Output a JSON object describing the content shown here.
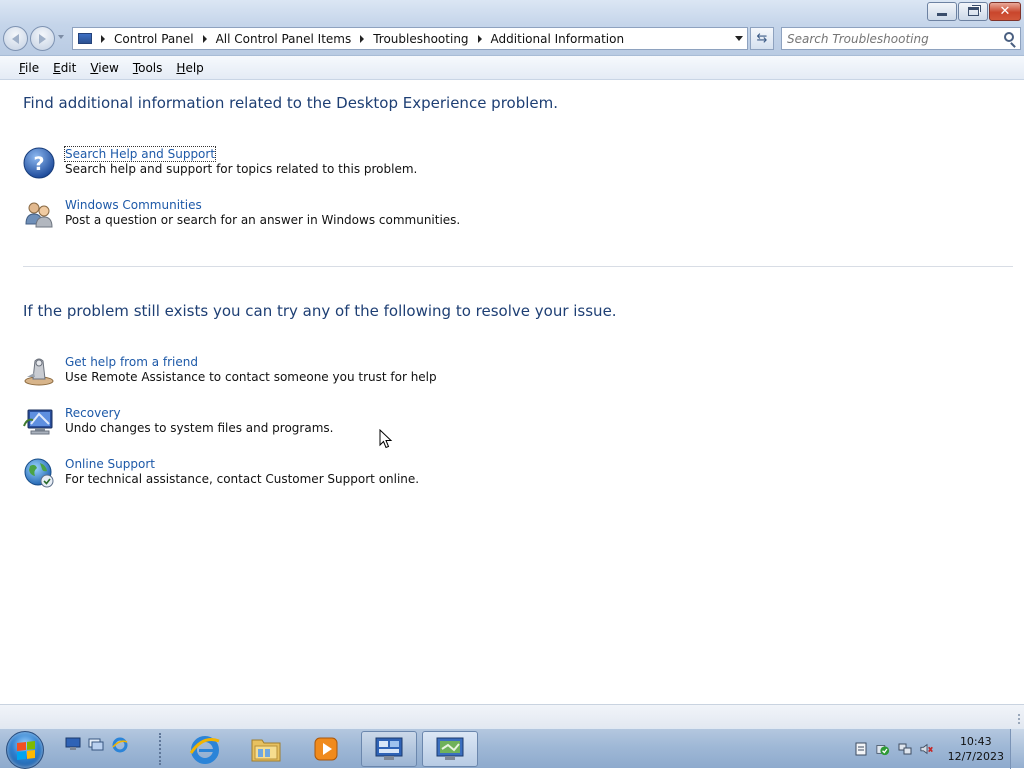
{
  "window": {
    "caption": {
      "minimize": "minimize",
      "restore": "restore",
      "close": "close"
    }
  },
  "navigation": {
    "breadcrumb": [
      "Control Panel",
      "All Control Panel Items",
      "Troubleshooting",
      "Additional Information"
    ],
    "search_placeholder": "Search Troubleshooting"
  },
  "menu": [
    "File",
    "Edit",
    "View",
    "Tools",
    "Help"
  ],
  "content": {
    "heading1": "Find additional information related to the Desktop Experience problem.",
    "section1": [
      {
        "icon": "help-question-icon",
        "link": "Search Help and Support",
        "desc": "Search help and support for topics related to this problem."
      },
      {
        "icon": "communities-people-icon",
        "link": "Windows Communities",
        "desc": "Post a question or search for an answer in Windows communities."
      }
    ],
    "heading2": "If the problem still exists you can try any of the following to resolve your issue.",
    "section2": [
      {
        "icon": "remote-assistance-icon",
        "link": "Get help from a friend",
        "desc": "Use Remote Assistance to contact someone you trust for help"
      },
      {
        "icon": "recovery-icon",
        "link": "Recovery",
        "desc": "Undo changes to system files and programs."
      },
      {
        "icon": "online-support-globe-icon",
        "link": "Online Support",
        "desc": "For technical assistance, contact Customer Support online."
      }
    ]
  },
  "taskbar": {
    "clock_time": "10:43",
    "clock_date": "12/7/2023"
  },
  "colors": {
    "heading": "#1e3f74",
    "link": "#1d59a8"
  }
}
